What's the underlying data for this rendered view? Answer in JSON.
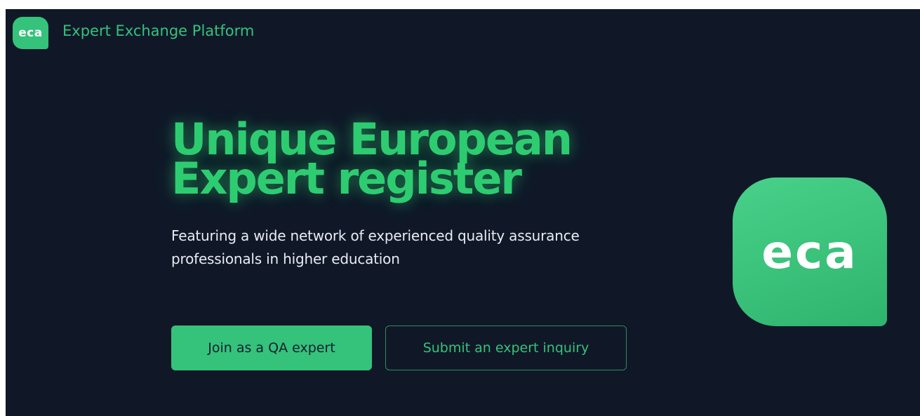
{
  "nav": {
    "logo_text": "eca",
    "title": "Expert Exchange Platform"
  },
  "hero": {
    "headline_line1": "Unique European",
    "headline_line2": "Expert register",
    "subtitle_line1": "Featuring a wide network of experienced quality assurance",
    "subtitle_line2": "professionals in higher education",
    "primary_button": "Join as a QA expert",
    "secondary_button": "Submit an expert inquiry"
  },
  "brand": {
    "logo_text": "eca",
    "accent_color": "#35c27a",
    "background_color": "#101828"
  }
}
